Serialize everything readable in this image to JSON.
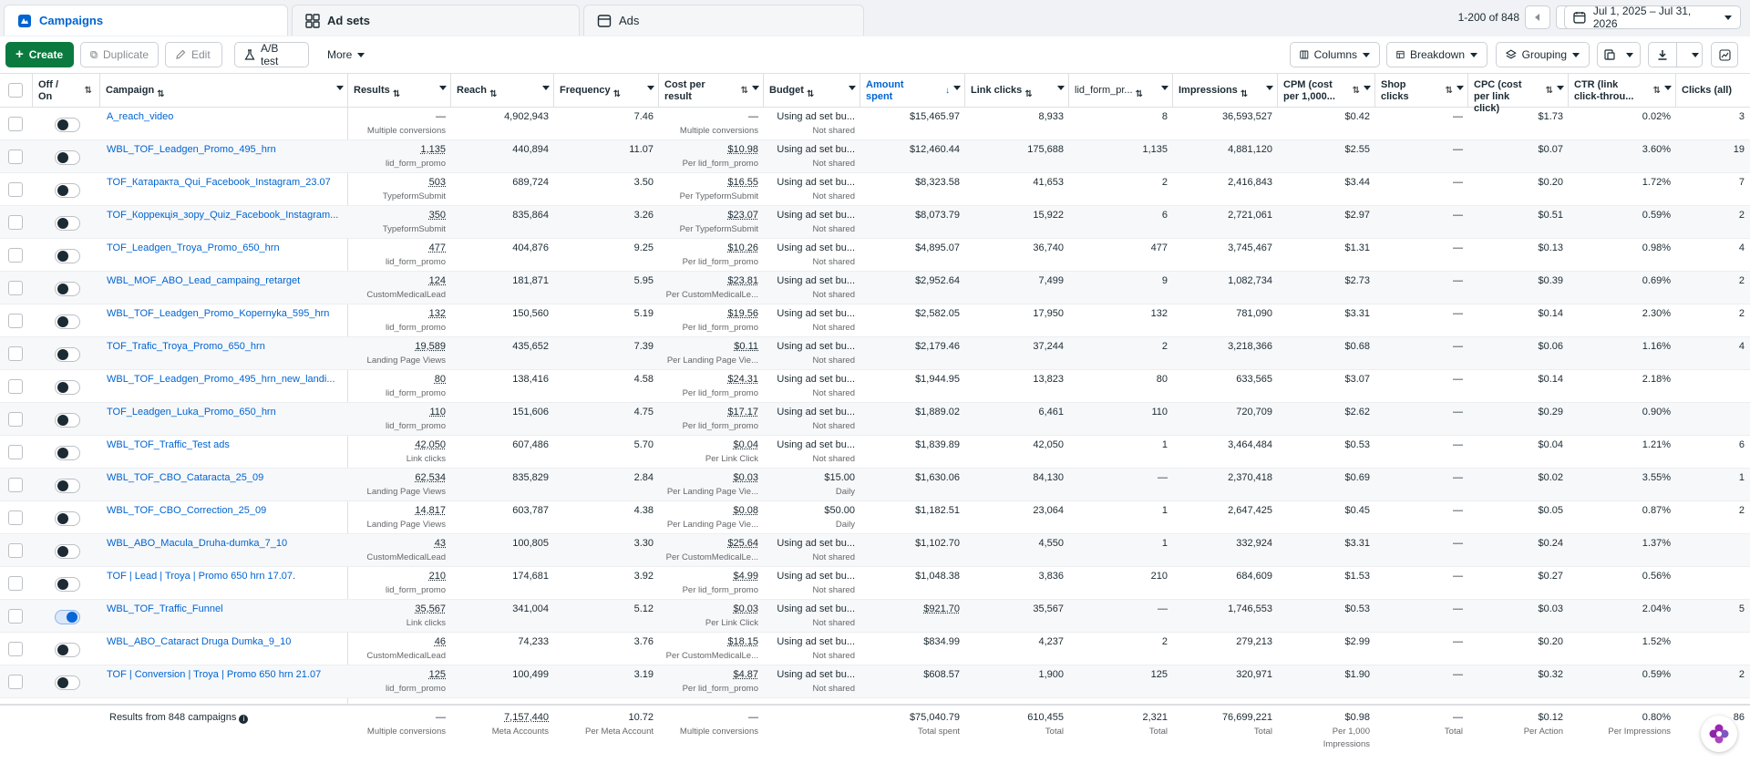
{
  "tabs": [
    {
      "label": "Campaigns",
      "icon": "campaigns-icon"
    },
    {
      "label": "Ad sets",
      "icon": "ad-sets-icon"
    },
    {
      "label": "Ads",
      "icon": "ads-icon"
    }
  ],
  "pager": {
    "range_text": "1-200 of 848"
  },
  "date_range": "Jul 1, 2025 – Jul 31, 2026",
  "toolbar": {
    "create": "Create",
    "duplicate": "Duplicate",
    "edit": "Edit",
    "ab_test": "A/B test",
    "more": "More",
    "columns": "Columns",
    "breakdown": "Breakdown",
    "grouping": "Grouping"
  },
  "headers": {
    "offon": "Off / On",
    "campaign": "Campaign",
    "results": "Results",
    "reach": "Reach",
    "frequency": "Frequency",
    "cost_per_result": "Cost per result",
    "budget": "Budget",
    "amount_spent": "Amount spent",
    "link_clicks": "Link clicks",
    "lid_form": "lid_form_pr...",
    "impressions": "Impressions",
    "cpm": "CPM (cost per 1,000...",
    "shop_clicks": "Shop clicks",
    "cpc": "CPC (cost per link click)",
    "ctr": "CTR (link click-throu...",
    "clicks_all": "Clicks (all)"
  },
  "rows": [
    {
      "on": false,
      "name": "A_reach_video",
      "results": "—",
      "results_sub": "Multiple conversions",
      "reach": "4,902,943",
      "freq": "7.46",
      "cpr": "—",
      "cpr_sub": "Multiple conversions",
      "budget": "Using ad set bu...",
      "budget_sub": "Not shared",
      "spent": "$15,465.97",
      "link_clicks": "8,933",
      "lid": "8",
      "impr": "36,593,527",
      "cpm": "$0.42",
      "shop": "—",
      "cpc": "$1.73",
      "ctr": "0.02%",
      "clicks": "3"
    },
    {
      "on": false,
      "name": "WBL_TOF_Leadgen_Promo_495_hrn",
      "results": "1,135",
      "results_sub": "lid_form_promo",
      "reach": "440,894",
      "freq": "11.07",
      "cpr": "$10.98",
      "cpr_sub": "Per lid_form_promo",
      "budget": "Using ad set bu...",
      "budget_sub": "Not shared",
      "spent": "$12,460.44",
      "link_clicks": "175,688",
      "lid": "1,135",
      "impr": "4,881,120",
      "cpm": "$2.55",
      "shop": "—",
      "cpc": "$0.07",
      "ctr": "3.60%",
      "clicks": "19"
    },
    {
      "on": false,
      "name": "TOF_Катаракта_Qui_Facebook_Instagram_23.07",
      "results": "503",
      "results_sub": "TypeformSubmit",
      "reach": "689,724",
      "freq": "3.50",
      "cpr": "$16.55",
      "cpr_sub": "Per TypeformSubmit",
      "budget": "Using ad set bu...",
      "budget_sub": "Not shared",
      "spent": "$8,323.58",
      "link_clicks": "41,653",
      "lid": "2",
      "impr": "2,416,843",
      "cpm": "$3.44",
      "shop": "—",
      "cpc": "$0.20",
      "ctr": "1.72%",
      "clicks": "7"
    },
    {
      "on": false,
      "name": "TOF_Коррекція_зору_Quiz_Facebook_Instagram...",
      "results": "350",
      "results_sub": "TypeformSubmit",
      "reach": "835,864",
      "freq": "3.26",
      "cpr": "$23.07",
      "cpr_sub": "Per TypeformSubmit",
      "budget": "Using ad set bu...",
      "budget_sub": "Not shared",
      "spent": "$8,073.79",
      "link_clicks": "15,922",
      "lid": "6",
      "impr": "2,721,061",
      "cpm": "$2.97",
      "shop": "—",
      "cpc": "$0.51",
      "ctr": "0.59%",
      "clicks": "2"
    },
    {
      "on": false,
      "name": "TOF_Leadgen_Troya_Promo_650_hrn",
      "results": "477",
      "results_sub": "lid_form_promo",
      "reach": "404,876",
      "freq": "9.25",
      "cpr": "$10.26",
      "cpr_sub": "Per lid_form_promo",
      "budget": "Using ad set bu...",
      "budget_sub": "Not shared",
      "spent": "$4,895.07",
      "link_clicks": "36,740",
      "lid": "477",
      "impr": "3,745,467",
      "cpm": "$1.31",
      "shop": "—",
      "cpc": "$0.13",
      "ctr": "0.98%",
      "clicks": "4"
    },
    {
      "on": false,
      "name": "WBL_MOF_ABO_Lead_campaing_retarget",
      "results": "124",
      "results_sub": "CustomMedicalLead",
      "reach": "181,871",
      "freq": "5.95",
      "cpr": "$23.81",
      "cpr_sub": "Per CustomMedicalLe...",
      "budget": "Using ad set bu...",
      "budget_sub": "Not shared",
      "spent": "$2,952.64",
      "link_clicks": "7,499",
      "lid": "9",
      "impr": "1,082,734",
      "cpm": "$2.73",
      "shop": "—",
      "cpc": "$0.39",
      "ctr": "0.69%",
      "clicks": "2"
    },
    {
      "on": false,
      "name": "WBL_TOF_Leadgen_Promo_Kopernyka_595_hrn",
      "results": "132",
      "results_sub": "lid_form_promo",
      "reach": "150,560",
      "freq": "5.19",
      "cpr": "$19.56",
      "cpr_sub": "Per lid_form_promo",
      "budget": "Using ad set bu...",
      "budget_sub": "Not shared",
      "spent": "$2,582.05",
      "link_clicks": "17,950",
      "lid": "132",
      "impr": "781,090",
      "cpm": "$3.31",
      "shop": "—",
      "cpc": "$0.14",
      "ctr": "2.30%",
      "clicks": "2"
    },
    {
      "on": false,
      "name": "TOF_Trafic_Troya_Promo_650_hrn",
      "results": "19,589",
      "results_sub": "Landing Page Views",
      "reach": "435,652",
      "freq": "7.39",
      "cpr": "$0.11",
      "cpr_sub": "Per Landing Page Vie...",
      "budget": "Using ad set bu...",
      "budget_sub": "Not shared",
      "spent": "$2,179.46",
      "link_clicks": "37,244",
      "lid": "2",
      "impr": "3,218,366",
      "cpm": "$0.68",
      "shop": "—",
      "cpc": "$0.06",
      "ctr": "1.16%",
      "clicks": "4"
    },
    {
      "on": false,
      "name": "WBL_TOF_Leadgen_Promo_495_hrn_new_landi...",
      "results": "80",
      "results_sub": "lid_form_promo",
      "reach": "138,416",
      "freq": "4.58",
      "cpr": "$24.31",
      "cpr_sub": "Per lid_form_promo",
      "budget": "Using ad set bu...",
      "budget_sub": "Not shared",
      "spent": "$1,944.95",
      "link_clicks": "13,823",
      "lid": "80",
      "impr": "633,565",
      "cpm": "$3.07",
      "shop": "—",
      "cpc": "$0.14",
      "ctr": "2.18%",
      "clicks": ""
    },
    {
      "on": false,
      "name": "TOF_Leadgen_Luka_Promo_650_hrn",
      "results": "110",
      "results_sub": "lid_form_promo",
      "reach": "151,606",
      "freq": "4.75",
      "cpr": "$17.17",
      "cpr_sub": "Per lid_form_promo",
      "budget": "Using ad set bu...",
      "budget_sub": "Not shared",
      "spent": "$1,889.02",
      "link_clicks": "6,461",
      "lid": "110",
      "impr": "720,709",
      "cpm": "$2.62",
      "shop": "—",
      "cpc": "$0.29",
      "ctr": "0.90%",
      "clicks": ""
    },
    {
      "on": false,
      "name": "WBL_TOF_Traffic_Test ads",
      "results": "42,050",
      "results_sub": "Link clicks",
      "reach": "607,486",
      "freq": "5.70",
      "cpr": "$0.04",
      "cpr_sub": "Per Link Click",
      "budget": "Using ad set bu...",
      "budget_sub": "Not shared",
      "spent": "$1,839.89",
      "link_clicks": "42,050",
      "lid": "1",
      "impr": "3,464,484",
      "cpm": "$0.53",
      "shop": "—",
      "cpc": "$0.04",
      "ctr": "1.21%",
      "clicks": "6"
    },
    {
      "on": false,
      "name": "WBL_TOF_CBO_Cataracta_25_09",
      "results": "62,534",
      "results_sub": "Landing Page Views",
      "reach": "835,829",
      "freq": "2.84",
      "cpr": "$0.03",
      "cpr_sub": "Per Landing Page Vie...",
      "budget": "$15.00",
      "budget_sub": "Daily",
      "spent": "$1,630.06",
      "link_clicks": "84,130",
      "lid": "—",
      "impr": "2,370,418",
      "cpm": "$0.69",
      "shop": "—",
      "cpc": "$0.02",
      "ctr": "3.55%",
      "clicks": "1"
    },
    {
      "on": false,
      "name": "WBL_TOF_CBO_Correction_25_09",
      "results": "14,817",
      "results_sub": "Landing Page Views",
      "reach": "603,787",
      "freq": "4.38",
      "cpr": "$0.08",
      "cpr_sub": "Per Landing Page Vie...",
      "budget": "$50.00",
      "budget_sub": "Daily",
      "spent": "$1,182.51",
      "link_clicks": "23,064",
      "lid": "1",
      "impr": "2,647,425",
      "cpm": "$0.45",
      "shop": "—",
      "cpc": "$0.05",
      "ctr": "0.87%",
      "clicks": "2"
    },
    {
      "on": false,
      "name": "WBL_ABO_Macula_Druha-dumka_7_10",
      "results": "43",
      "results_sub": "CustomMedicalLead",
      "reach": "100,805",
      "freq": "3.30",
      "cpr": "$25.64",
      "cpr_sub": "Per CustomMedicalLe...",
      "budget": "Using ad set bu...",
      "budget_sub": "Not shared",
      "spent": "$1,102.70",
      "link_clicks": "4,550",
      "lid": "1",
      "impr": "332,924",
      "cpm": "$3.31",
      "shop": "—",
      "cpc": "$0.24",
      "ctr": "1.37%",
      "clicks": ""
    },
    {
      "on": false,
      "name": "TOF | Lead | Troya | Promo 650 hrn 17.07.",
      "results": "210",
      "results_sub": "lid_form_promo",
      "reach": "174,681",
      "freq": "3.92",
      "cpr": "$4.99",
      "cpr_sub": "Per lid_form_promo",
      "budget": "Using ad set bu...",
      "budget_sub": "Not shared",
      "spent": "$1,048.38",
      "link_clicks": "3,836",
      "lid": "210",
      "impr": "684,609",
      "cpm": "$1.53",
      "shop": "—",
      "cpc": "$0.27",
      "ctr": "0.56%",
      "clicks": ""
    },
    {
      "on": true,
      "name": "WBL_TOF_Traffic_Funnel",
      "results": "35,567",
      "results_sub": "Link clicks",
      "reach": "341,004",
      "freq": "5.12",
      "cpr": "$0.03",
      "cpr_sub": "Per Link Click",
      "budget": "Using ad set bu...",
      "budget_sub": "Not shared",
      "spent": "$921.70",
      "link_clicks": "35,567",
      "lid": "—",
      "impr": "1,746,553",
      "cpm": "$0.53",
      "shop": "—",
      "cpc": "$0.03",
      "ctr": "2.04%",
      "clicks": "5"
    },
    {
      "on": false,
      "name": "WBL_ABO_Cataract Druga Dumka_9_10",
      "results": "46",
      "results_sub": "CustomMedicalLead",
      "reach": "74,233",
      "freq": "3.76",
      "cpr": "$18.15",
      "cpr_sub": "Per CustomMedicalLe...",
      "budget": "Using ad set bu...",
      "budget_sub": "Not shared",
      "spent": "$834.99",
      "link_clicks": "4,237",
      "lid": "2",
      "impr": "279,213",
      "cpm": "$2.99",
      "shop": "—",
      "cpc": "$0.20",
      "ctr": "1.52%",
      "clicks": ""
    },
    {
      "on": false,
      "name": "TOF | Conversion | Troya | Promo 650 hrn 21.07",
      "results": "125",
      "results_sub": "lid_form_promo",
      "reach": "100,499",
      "freq": "3.19",
      "cpr": "$4.87",
      "cpr_sub": "Per lid_form_promo",
      "budget": "Using ad set bu...",
      "budget_sub": "Not shared",
      "spent": "$608.57",
      "link_clicks": "1,900",
      "lid": "125",
      "impr": "320,971",
      "cpm": "$1.90",
      "shop": "—",
      "cpc": "$0.32",
      "ctr": "0.59%",
      "clicks": "2"
    }
  ],
  "footer": {
    "label": "Results from 848 campaigns",
    "results": "—",
    "results_sub": "Multiple conversions",
    "reach": "7,157,440",
    "reach_sub": "Meta Accounts",
    "freq": "10.72",
    "freq_sub": "Per Meta Account",
    "cpr": "—",
    "cpr_sub": "Multiple conversions",
    "spent": "$75,040.79",
    "spent_sub": "Total spent",
    "link_clicks": "610,455",
    "link_clicks_sub": "Total",
    "lid": "2,321",
    "lid_sub": "Total",
    "impr": "76,699,221",
    "impr_sub": "Total",
    "cpm": "$0.98",
    "cpm_sub": "Per 1,000 Impressions",
    "shop": "—",
    "shop_sub": "Total",
    "cpc": "$0.12",
    "cpc_sub": "Per Action",
    "ctr": "0.80%",
    "ctr_sub": "Per Impressions",
    "clicks": "86"
  },
  "colors": {
    "accent": "#0064d1",
    "create": "#0b7a3e",
    "toggle_on": "#0a66d6"
  }
}
